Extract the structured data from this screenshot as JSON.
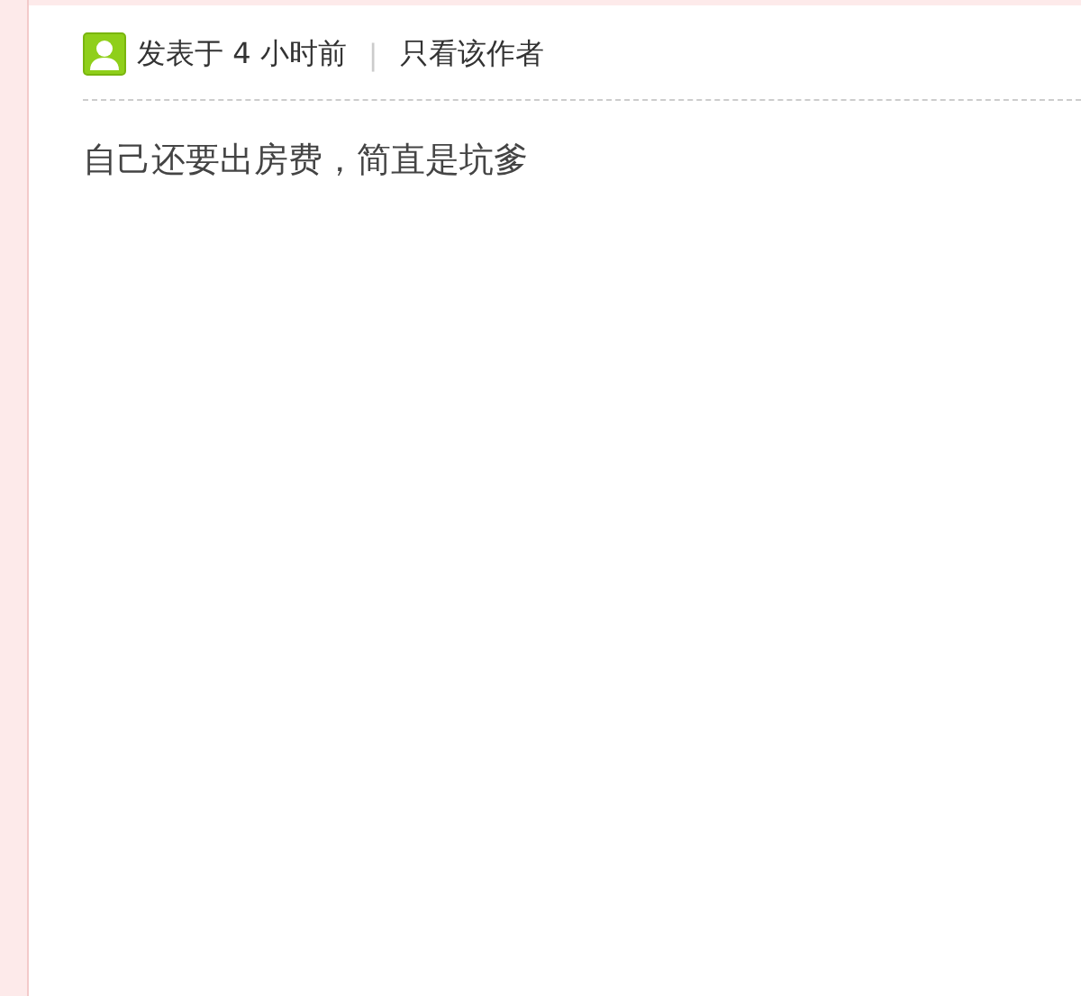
{
  "post": {
    "posted": "发表于 4 小时前",
    "separator": "|",
    "author_filter": "只看该作者",
    "content": "自己还要出房费，简直是坑爹"
  }
}
